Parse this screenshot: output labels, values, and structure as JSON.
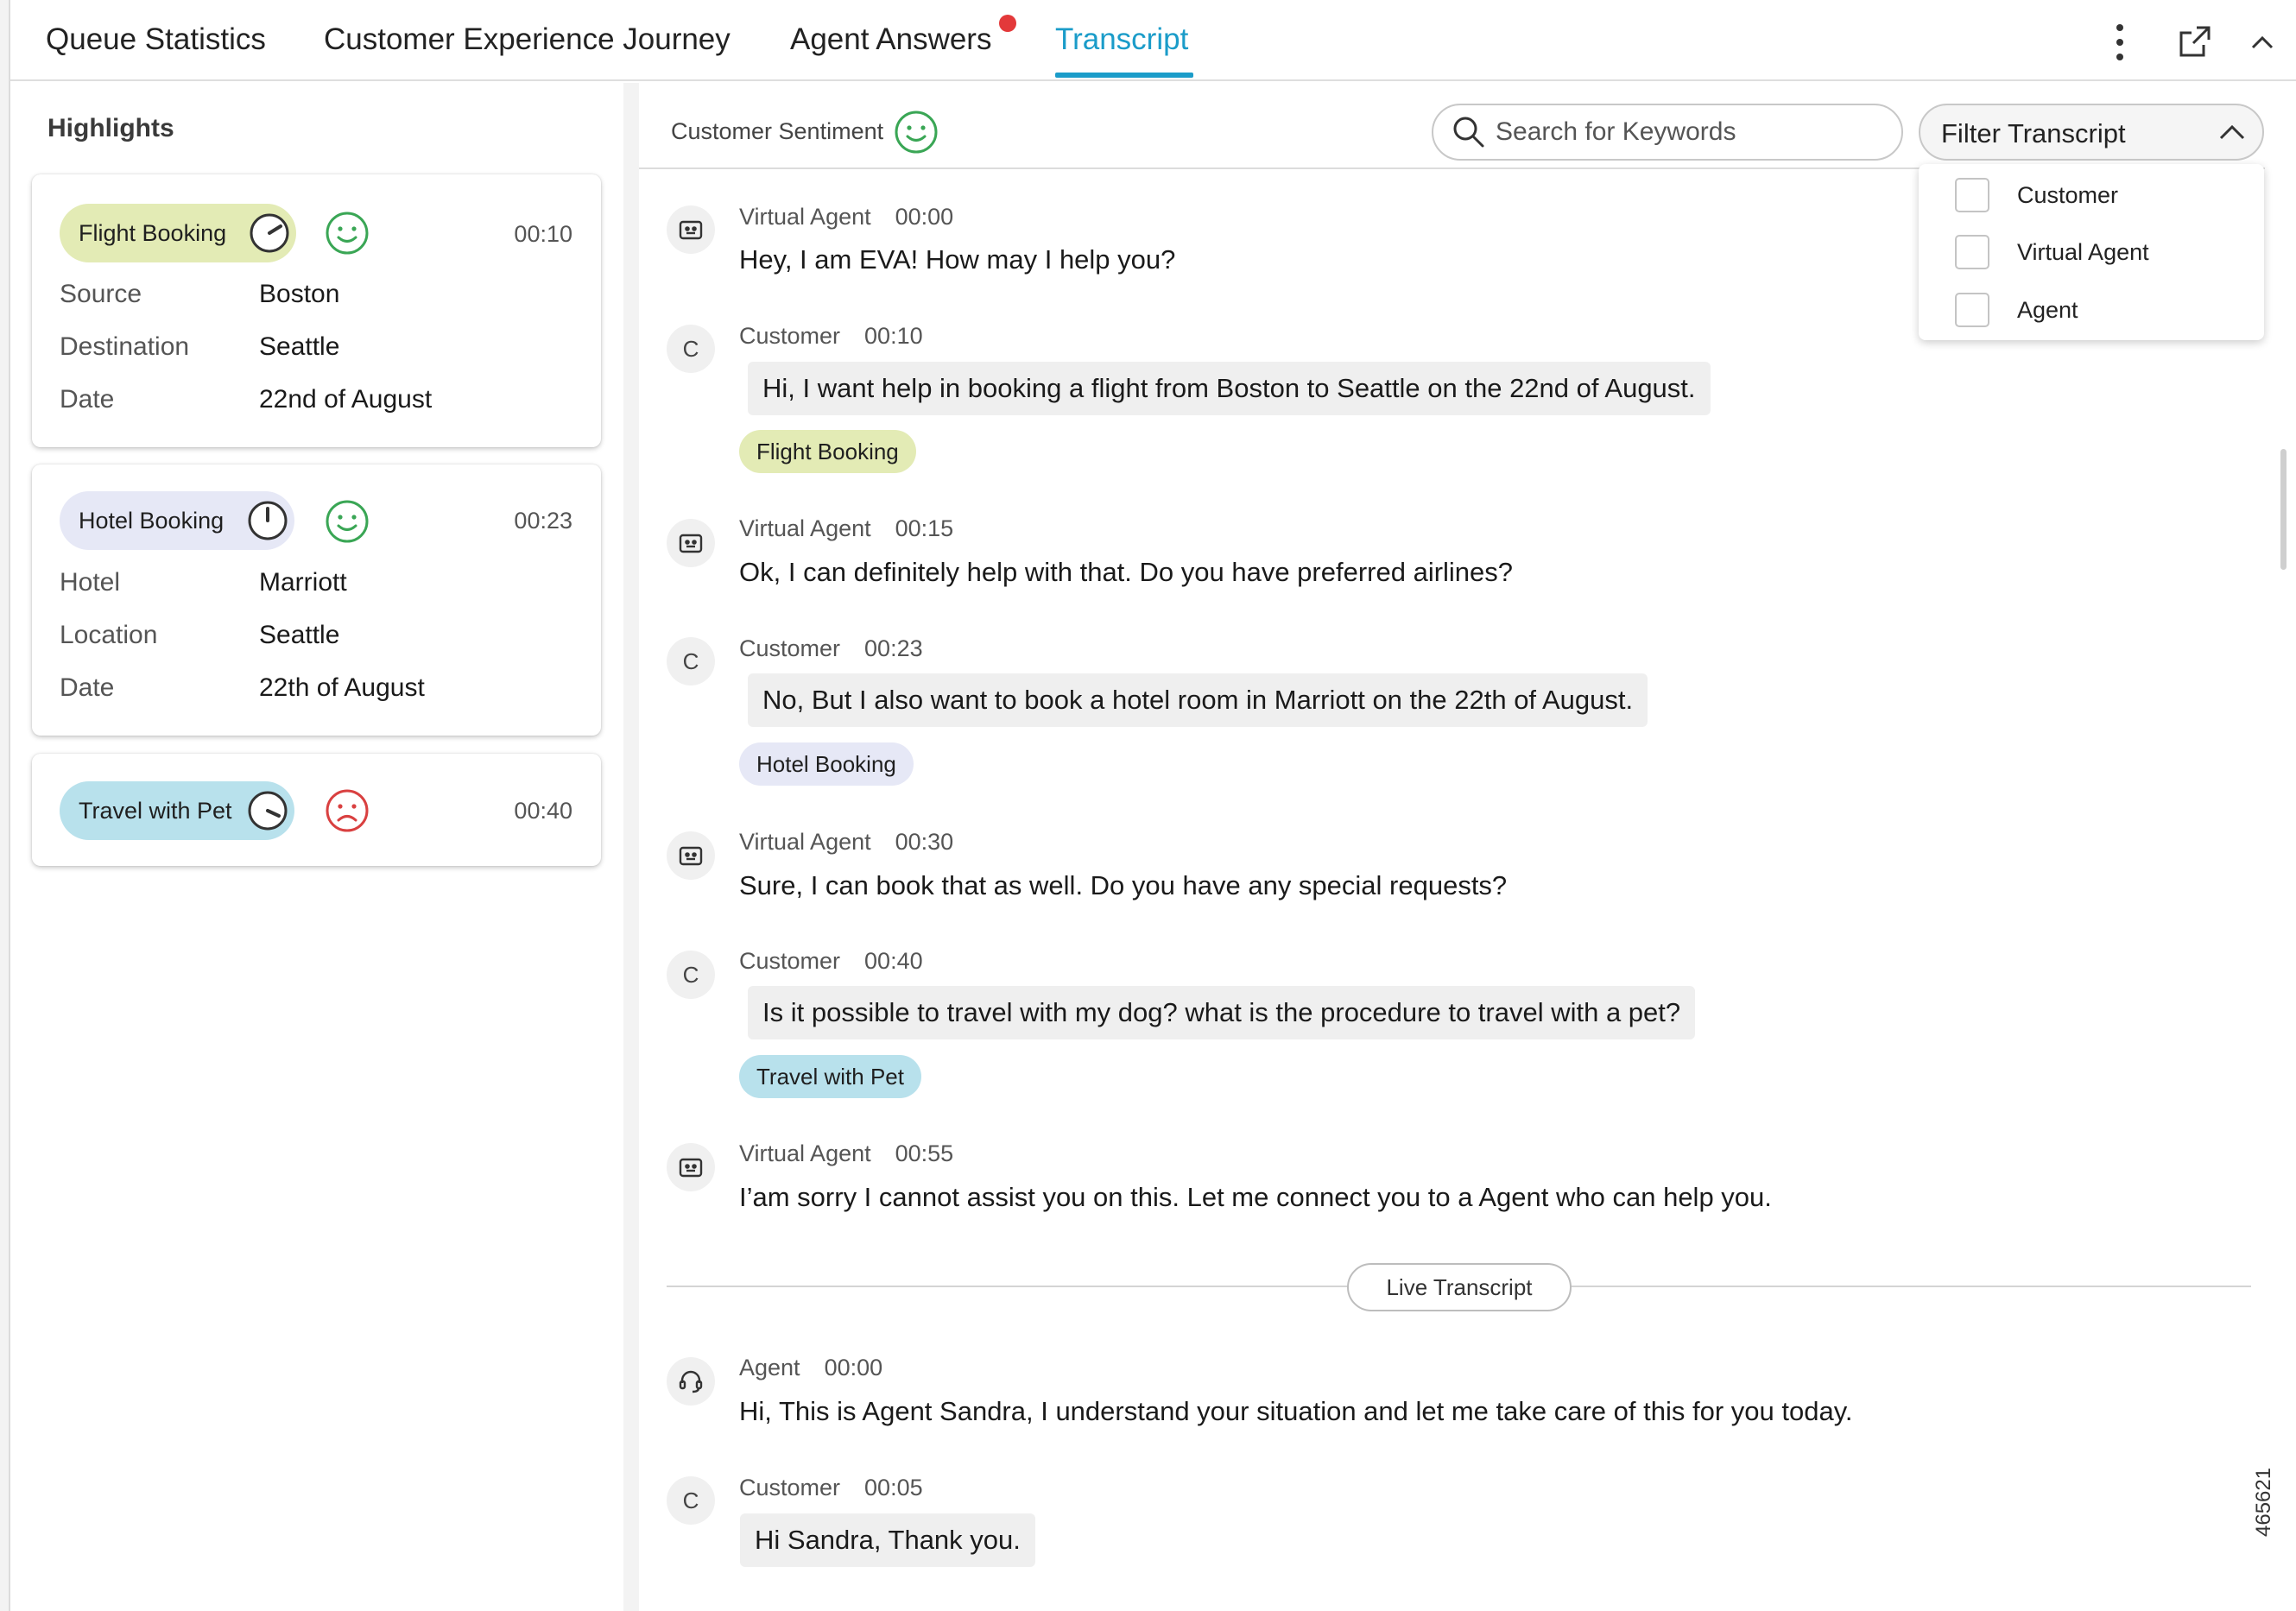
{
  "tabs": [
    {
      "label": "Queue Statistics"
    },
    {
      "label": "Customer Experience Journey"
    },
    {
      "label": "Agent Answers"
    },
    {
      "label": "Transcript"
    }
  ],
  "colors": {
    "accent": "#1b9cc9",
    "notification": "#e3393a",
    "positive": "#3aa655",
    "negative": "#d94040",
    "tag_flight": "#e3ebb5",
    "tag_hotel": "#e6e8f6",
    "tag_pet": "#b8e1ec"
  },
  "highlights": {
    "title": "Highlights",
    "cards": [
      {
        "tag": "Flight Booking",
        "sentiment": "positive",
        "time": "00:10",
        "fields": [
          {
            "key": "Source",
            "value": "Boston"
          },
          {
            "key": "Destination",
            "value": "Seattle"
          },
          {
            "key": "Date",
            "value": "22nd of August"
          }
        ]
      },
      {
        "tag": "Hotel Booking",
        "sentiment": "positive",
        "time": "00:23",
        "fields": [
          {
            "key": "Hotel",
            "value": "Marriott"
          },
          {
            "key": "Location",
            "value": "Seattle"
          },
          {
            "key": "Date",
            "value": "22th of August"
          }
        ]
      },
      {
        "tag": "Travel with Pet",
        "sentiment": "negative",
        "time": "00:40",
        "fields": []
      }
    ]
  },
  "transcript": {
    "sentiment_label": "Customer Sentiment",
    "search_placeholder": "Search for Keywords",
    "filter_label": "Filter Transcript",
    "filter_options": [
      "Customer",
      "Virtual Agent",
      "Agent"
    ],
    "messages": [
      {
        "speaker": "Virtual Agent",
        "time": "00:00",
        "text": "Hey, I am EVA! How may I help you?"
      },
      {
        "speaker": "Customer",
        "avatar": "C",
        "time": "00:10",
        "text": "Hi, I want help in booking a flight from Boston to Seattle on the 22nd of August.",
        "tag": "Flight Booking"
      },
      {
        "speaker": "Virtual Agent",
        "time": "00:15",
        "text": "Ok, I can definitely help with that. Do you have preferred airlines?"
      },
      {
        "speaker": "Customer",
        "avatar": "C",
        "time": "00:23",
        "text": "No, But I also want to book a hotel room in Marriott on the 22th of August.",
        "tag": "Hotel Booking"
      },
      {
        "speaker": "Virtual Agent",
        "time": "00:30",
        "text": "Sure, I can book that as well. Do you have any special requests?"
      },
      {
        "speaker": "Customer",
        "avatar": "C",
        "time": "00:40",
        "text": "Is it possible to travel with my dog? what is the procedure to travel with a pet?",
        "tag": "Travel with Pet"
      },
      {
        "speaker": "Virtual Agent",
        "time": "00:55",
        "text": "I’am sorry I cannot assist you on this. Let me connect you to a Agent who can help you."
      }
    ],
    "live_label": "Live Transcript",
    "live_messages": [
      {
        "speaker": "Agent",
        "time": "00:00",
        "text": "Hi, This is Agent Sandra, I understand your situation and let me take care of this for you today."
      },
      {
        "speaker": "Customer",
        "avatar": "C",
        "time": "00:05",
        "text": "Hi Sandra, Thank you."
      }
    ]
  },
  "figure_id": "465621"
}
